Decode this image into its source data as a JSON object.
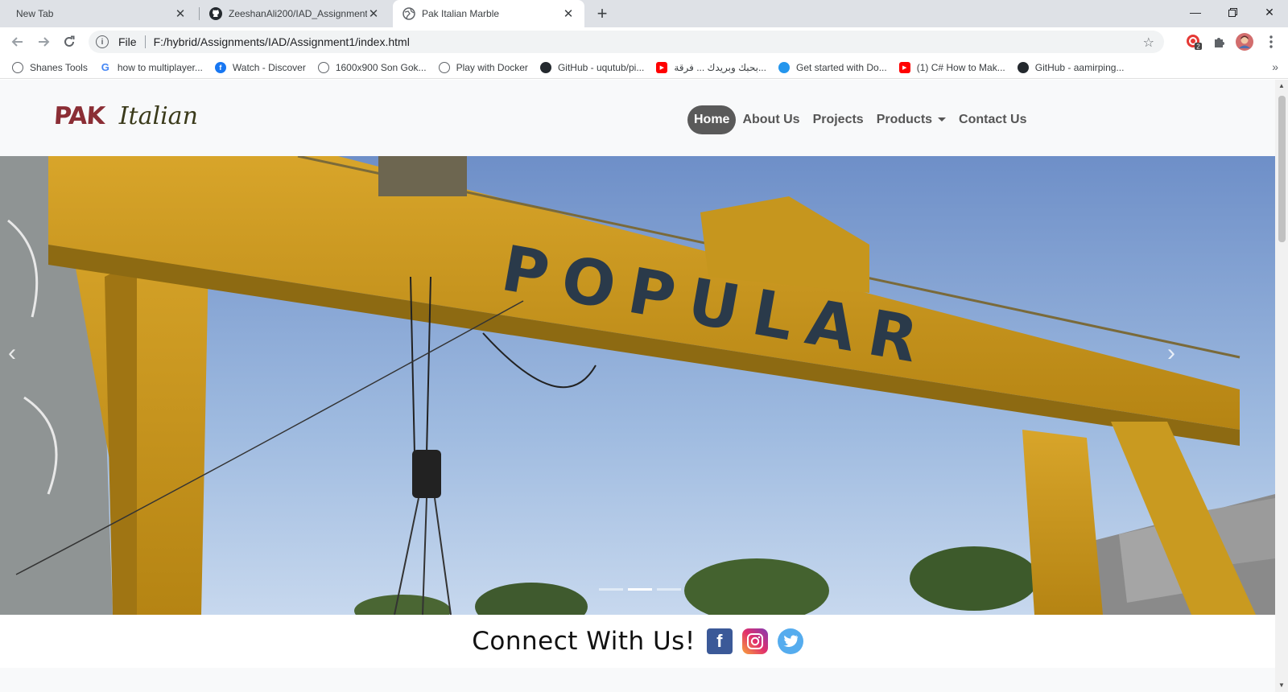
{
  "browser": {
    "tabs": [
      {
        "title": "New Tab",
        "active": false
      },
      {
        "title": "ZeeshanAli200/IAD_Assignment1",
        "active": false
      },
      {
        "title": "Pak Italian Marble",
        "active": true
      }
    ],
    "address": {
      "scheme": "File",
      "url": "F:/hybrid/Assignments/IAD/Assignment1/index.html"
    },
    "extension_badge": "2",
    "bookmarks": [
      {
        "label": "Shanes Tools",
        "icon": "globe-icon"
      },
      {
        "label": "how to multiplayer...",
        "icon": "google-icon"
      },
      {
        "label": "Watch - Discover",
        "icon": "facebook-icon"
      },
      {
        "label": "1600x900 Son Gok...",
        "icon": "globe-icon"
      },
      {
        "label": "Play with Docker",
        "icon": "globe-icon"
      },
      {
        "label": "GitHub - uqutub/pi...",
        "icon": "github-icon"
      },
      {
        "label": "بحبك وبريدك ... فرقة...",
        "icon": "youtube-icon"
      },
      {
        "label": "Get started with Do...",
        "icon": "docker-icon"
      },
      {
        "label": "(1) C# How to Mak...",
        "icon": "youtube-icon"
      },
      {
        "label": "GitHub - aamirping...",
        "icon": "github-icon"
      }
    ]
  },
  "site": {
    "logo": {
      "pak": "PAK",
      "italian": "Italian"
    },
    "nav": {
      "home": "Home",
      "about": "About Us",
      "projects": "Projects",
      "products": "Products",
      "contact": "Contact Us"
    },
    "hero": {
      "crane_text": "POPULAR",
      "slide_count": 3,
      "active_slide": 2
    },
    "connect": {
      "text": "Connect With Us!",
      "socials": [
        "facebook-icon",
        "instagram-icon",
        "twitter-icon"
      ]
    }
  }
}
